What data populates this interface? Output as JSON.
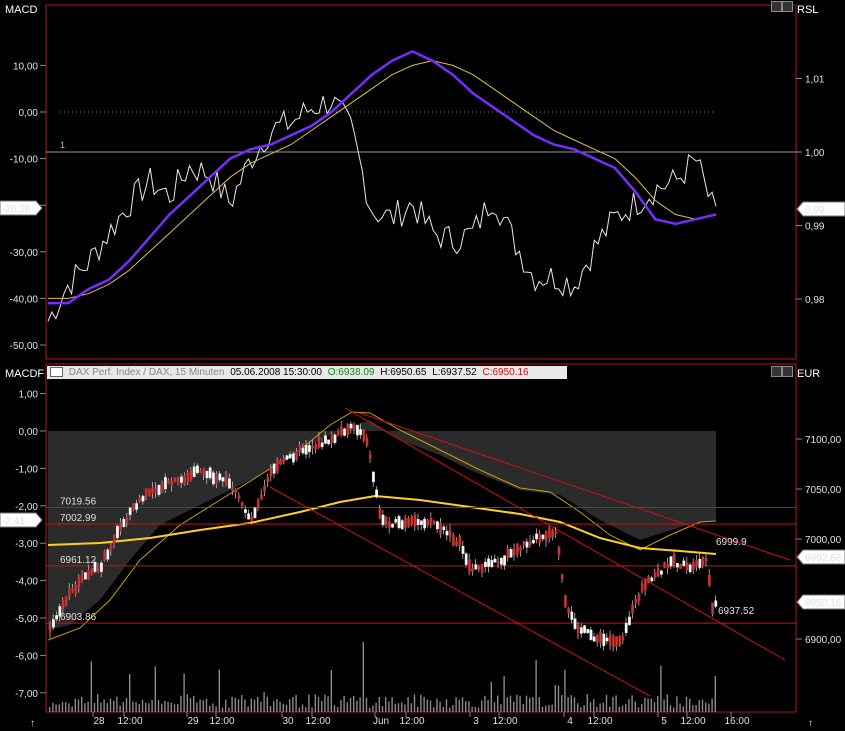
{
  "top_panel": {
    "left_title": "MACD",
    "right_title": "RSL",
    "left_ticks": [
      "10,00",
      "0,00",
      "-10,00",
      "-20,00",
      "-30,00",
      "-40,00",
      "-50,00"
    ],
    "left_tick_values": [
      10,
      0,
      -10,
      -20,
      -30,
      -40,
      -50
    ],
    "right_ticks": [
      "1,01",
      "1,00",
      "0,99",
      "0,98"
    ],
    "right_tick_values": [
      1.01,
      1.0,
      0.99,
      0.98
    ],
    "left_marker": "-20,36",
    "right_marker": "0,99",
    "level_label": "1"
  },
  "bottom_panel": {
    "left_title": "MACDF",
    "right_title": "EUR",
    "info_bar": {
      "date": "05.06.2008 15:30:00",
      "open": "O:6938.09",
      "high": "H:6950.65",
      "low": "L:6937.52",
      "close": "C:6950.16",
      "instrument": "DAX Perf. Index / DAX, 15 Minuten"
    },
    "left_ticks": [
      "1,00",
      "0,00",
      "-1,00",
      "-2,00",
      "-3,00",
      "-4,00",
      "-5,00",
      "-6,00",
      "-7,00"
    ],
    "left_tick_values": [
      1,
      0,
      -1,
      -2,
      -3,
      -4,
      -5,
      -6,
      -7
    ],
    "right_ticks": [
      "7100,00",
      "7050,00",
      "7000,00",
      "6900,00"
    ],
    "right_tick_values": [
      7100,
      7050,
      7000,
      6900
    ],
    "left_marker": "-2,41",
    "right_marker_upper": "6992,68",
    "right_marker_lower": "6950,16",
    "levels": [
      {
        "label": "7019.56",
        "value": 7019.56
      },
      {
        "label": "7002.99",
        "value": 7002.99
      },
      {
        "label": "6961.12",
        "value": 6961.12
      },
      {
        "label": "6903.86",
        "value": 6903.86
      }
    ],
    "annotation_high": "6999.9",
    "annotation_low": "6937.52"
  },
  "x_axis": {
    "labels": [
      "28",
      "12:00",
      "29",
      "12:00",
      "30",
      "12:00",
      "Jun",
      "12:00",
      "3",
      "12:00",
      "4",
      "12:00",
      "5",
      "12:00",
      "16:00"
    ]
  },
  "colors": {
    "macd_line": "#7a2cff",
    "signal_line": "#d8c04a",
    "rsl_line": "#e8e8e8",
    "ma_line": "#ffd21a",
    "band_line": "#c7a100",
    "level_line": "#d01010",
    "level_text": "#ff4040",
    "panel_border": "#b01818",
    "band_fill": "#2b2b2b"
  },
  "chart_data": [
    {
      "type": "line",
      "title": "MACD",
      "series": [
        {
          "name": "MACD",
          "values": [
            -41,
            -41,
            -38,
            -36,
            -32,
            -27,
            -22,
            -18,
            -14,
            -10,
            -8,
            -7,
            -5,
            -3,
            0,
            4,
            8,
            11,
            13,
            11,
            8,
            4,
            1,
            -2,
            -5,
            -7,
            -8,
            -10,
            -12,
            -17,
            -23,
            -24,
            -23,
            -22
          ]
        },
        {
          "name": "Signal",
          "values": [
            -40,
            -40,
            -39,
            -37,
            -34,
            -30,
            -26,
            -22,
            -18,
            -14,
            -11,
            -9,
            -7,
            -4,
            -1,
            2,
            5,
            8,
            10,
            11,
            10,
            8,
            5,
            2,
            -1,
            -4,
            -6,
            -8,
            -10,
            -14,
            -19,
            -22,
            -23,
            -22
          ]
        },
        {
          "name": "RSL",
          "values": [
            0.977,
            0.982,
            0.985,
            0.989,
            0.993,
            0.996,
            0.994,
            0.998,
            0.997,
            0.993,
            0.999,
            1.003,
            1.004,
            1.006,
            1.007,
            1.003,
            0.992,
            0.991,
            0.993,
            0.989,
            0.988,
            0.989,
            0.994,
            0.988,
            0.983,
            0.983,
            0.982,
            0.987,
            0.991,
            0.993,
            0.995,
            0.996,
            0.999,
            0.991
          ]
        }
      ],
      "ylim": [
        -53,
        16
      ]
    },
    {
      "type": "candlestick",
      "title": "DAX Perf. Index / DAX, 15 Minuten",
      "ylim": [
        6870,
        7150
      ],
      "last": {
        "open": 6938.09,
        "high": 6950.65,
        "low": 6937.52,
        "close": 6950.16
      }
    }
  ]
}
